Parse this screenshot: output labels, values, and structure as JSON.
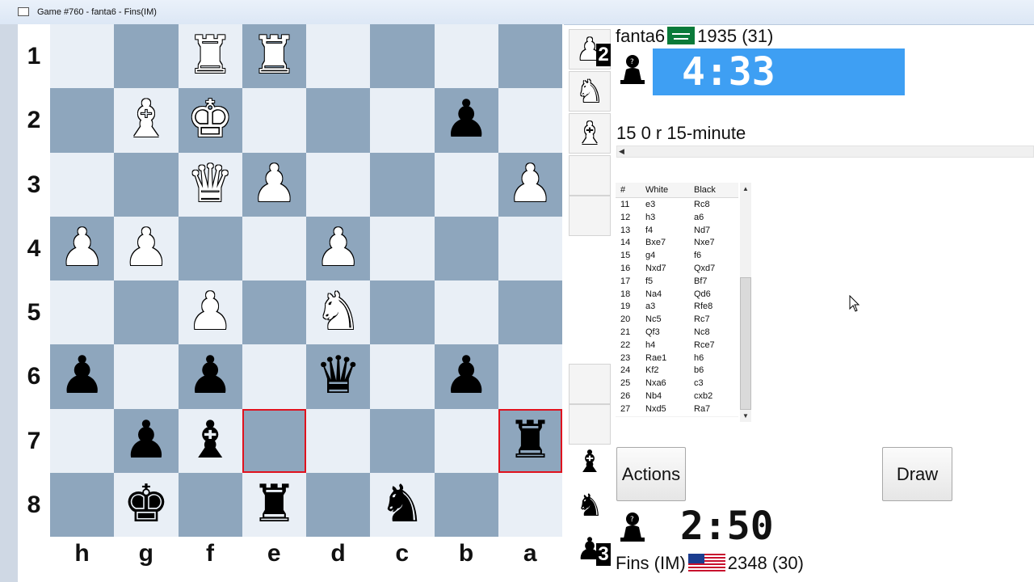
{
  "window": {
    "title": "Game #760 - fanta6 - Fins(IM)"
  },
  "board": {
    "ranks": [
      "1",
      "2",
      "3",
      "4",
      "5",
      "6",
      "7",
      "8"
    ],
    "files": [
      "h",
      "g",
      "f",
      "e",
      "d",
      "c",
      "b",
      "a"
    ],
    "highlight_squares": [
      "e7",
      "a7"
    ],
    "highlight_color": "#e0121e",
    "light_color": "#e9eff6",
    "dark_color": "#8ea6bd",
    "pieces": [
      {
        "sq": "f1",
        "color": "w",
        "type": "rook-icon",
        "glyph": "♜"
      },
      {
        "sq": "e1",
        "color": "w",
        "type": "rook-icon",
        "glyph": "♜"
      },
      {
        "sq": "g2",
        "color": "w",
        "type": "bishop-icon",
        "glyph": "♝"
      },
      {
        "sq": "f2",
        "color": "w",
        "type": "king-icon",
        "glyph": "♚"
      },
      {
        "sq": "b2",
        "color": "b",
        "type": "pawn-icon",
        "glyph": "♟"
      },
      {
        "sq": "f3",
        "color": "w",
        "type": "queen-icon",
        "glyph": "♛"
      },
      {
        "sq": "e3",
        "color": "w",
        "type": "pawn-icon",
        "glyph": "♟"
      },
      {
        "sq": "a3",
        "color": "w",
        "type": "pawn-icon",
        "glyph": "♟"
      },
      {
        "sq": "h4",
        "color": "w",
        "type": "pawn-icon",
        "glyph": "♟"
      },
      {
        "sq": "g4",
        "color": "w",
        "type": "pawn-icon",
        "glyph": "♟"
      },
      {
        "sq": "d4",
        "color": "w",
        "type": "pawn-icon",
        "glyph": "♟"
      },
      {
        "sq": "f5",
        "color": "w",
        "type": "pawn-icon",
        "glyph": "♟"
      },
      {
        "sq": "d5",
        "color": "w",
        "type": "knight-icon",
        "glyph": "♞"
      },
      {
        "sq": "h6",
        "color": "b",
        "type": "pawn-icon",
        "glyph": "♟"
      },
      {
        "sq": "f6",
        "color": "b",
        "type": "pawn-icon",
        "glyph": "♟"
      },
      {
        "sq": "d6",
        "color": "b",
        "type": "queen-icon",
        "glyph": "♛"
      },
      {
        "sq": "b6",
        "color": "b",
        "type": "pawn-icon",
        "glyph": "♟"
      },
      {
        "sq": "g7",
        "color": "b",
        "type": "pawn-icon",
        "glyph": "♟"
      },
      {
        "sq": "f7",
        "color": "b",
        "type": "bishop-icon",
        "glyph": "♝"
      },
      {
        "sq": "a7",
        "color": "b",
        "type": "rook-icon",
        "glyph": "♜"
      },
      {
        "sq": "g8",
        "color": "b",
        "type": "king-icon",
        "glyph": "♚"
      },
      {
        "sq": "e8",
        "color": "b",
        "type": "rook-icon",
        "glyph": "♜"
      },
      {
        "sq": "c8",
        "color": "b",
        "type": "knight-icon",
        "glyph": "♞"
      }
    ]
  },
  "captured_top": [
    {
      "color": "w",
      "type": "pawn-icon",
      "glyph": "♟",
      "count": "2"
    },
    {
      "color": "w",
      "type": "knight-icon",
      "glyph": "♞",
      "count": ""
    },
    {
      "color": "w",
      "type": "bishop-icon",
      "glyph": "♝",
      "count": ""
    }
  ],
  "captured_bottom": [
    {
      "color": "b",
      "type": "bishop-icon",
      "glyph": "♝",
      "count": ""
    },
    {
      "color": "b",
      "type": "knight-icon",
      "glyph": "♞",
      "count": ""
    },
    {
      "color": "b",
      "type": "pawn-icon",
      "glyph": "♟",
      "count": "3"
    }
  ],
  "top_player": {
    "name": "fanta6",
    "rating": "1935 (31)",
    "flag": "saudi-arabia-flag-icon",
    "clock": "4:33",
    "clock_bg": "#3e9ff3",
    "status_icon": "pawn-icon"
  },
  "game_info": "15 0 r 15-minute",
  "moves": {
    "headers": {
      "num": "#",
      "white": "White",
      "black": "Black"
    },
    "rows": [
      {
        "num": "11",
        "white": "e3",
        "black": "Rc8"
      },
      {
        "num": "12",
        "white": "h3",
        "black": "a6"
      },
      {
        "num": "13",
        "white": "f4",
        "black": "Nd7"
      },
      {
        "num": "14",
        "white": "Bxe7",
        "black": "Nxe7"
      },
      {
        "num": "15",
        "white": "g4",
        "black": "f6"
      },
      {
        "num": "16",
        "white": "Nxd7",
        "black": "Qxd7"
      },
      {
        "num": "17",
        "white": "f5",
        "black": "Bf7"
      },
      {
        "num": "18",
        "white": "Na4",
        "black": "Qd6"
      },
      {
        "num": "19",
        "white": "a3",
        "black": "Rfe8"
      },
      {
        "num": "20",
        "white": "Nc5",
        "black": "Rc7"
      },
      {
        "num": "21",
        "white": "Qf3",
        "black": "Nc8"
      },
      {
        "num": "22",
        "white": "h4",
        "black": "Rce7"
      },
      {
        "num": "23",
        "white": "Rae1",
        "black": "h6"
      },
      {
        "num": "24",
        "white": "Kf2",
        "black": "b6"
      },
      {
        "num": "25",
        "white": "Nxa6",
        "black": "c3"
      },
      {
        "num": "26",
        "white": "Nb4",
        "black": "cxb2"
      },
      {
        "num": "27",
        "white": "Nxd5",
        "black": "Ra7"
      }
    ]
  },
  "buttons": {
    "actions": "Actions",
    "draw": "Draw"
  },
  "bottom_player": {
    "name": "Fins (IM)",
    "rating": "2348 (30)",
    "flag": "usa-flag-icon",
    "clock": "2:50",
    "status_icon": "pawn-icon"
  }
}
